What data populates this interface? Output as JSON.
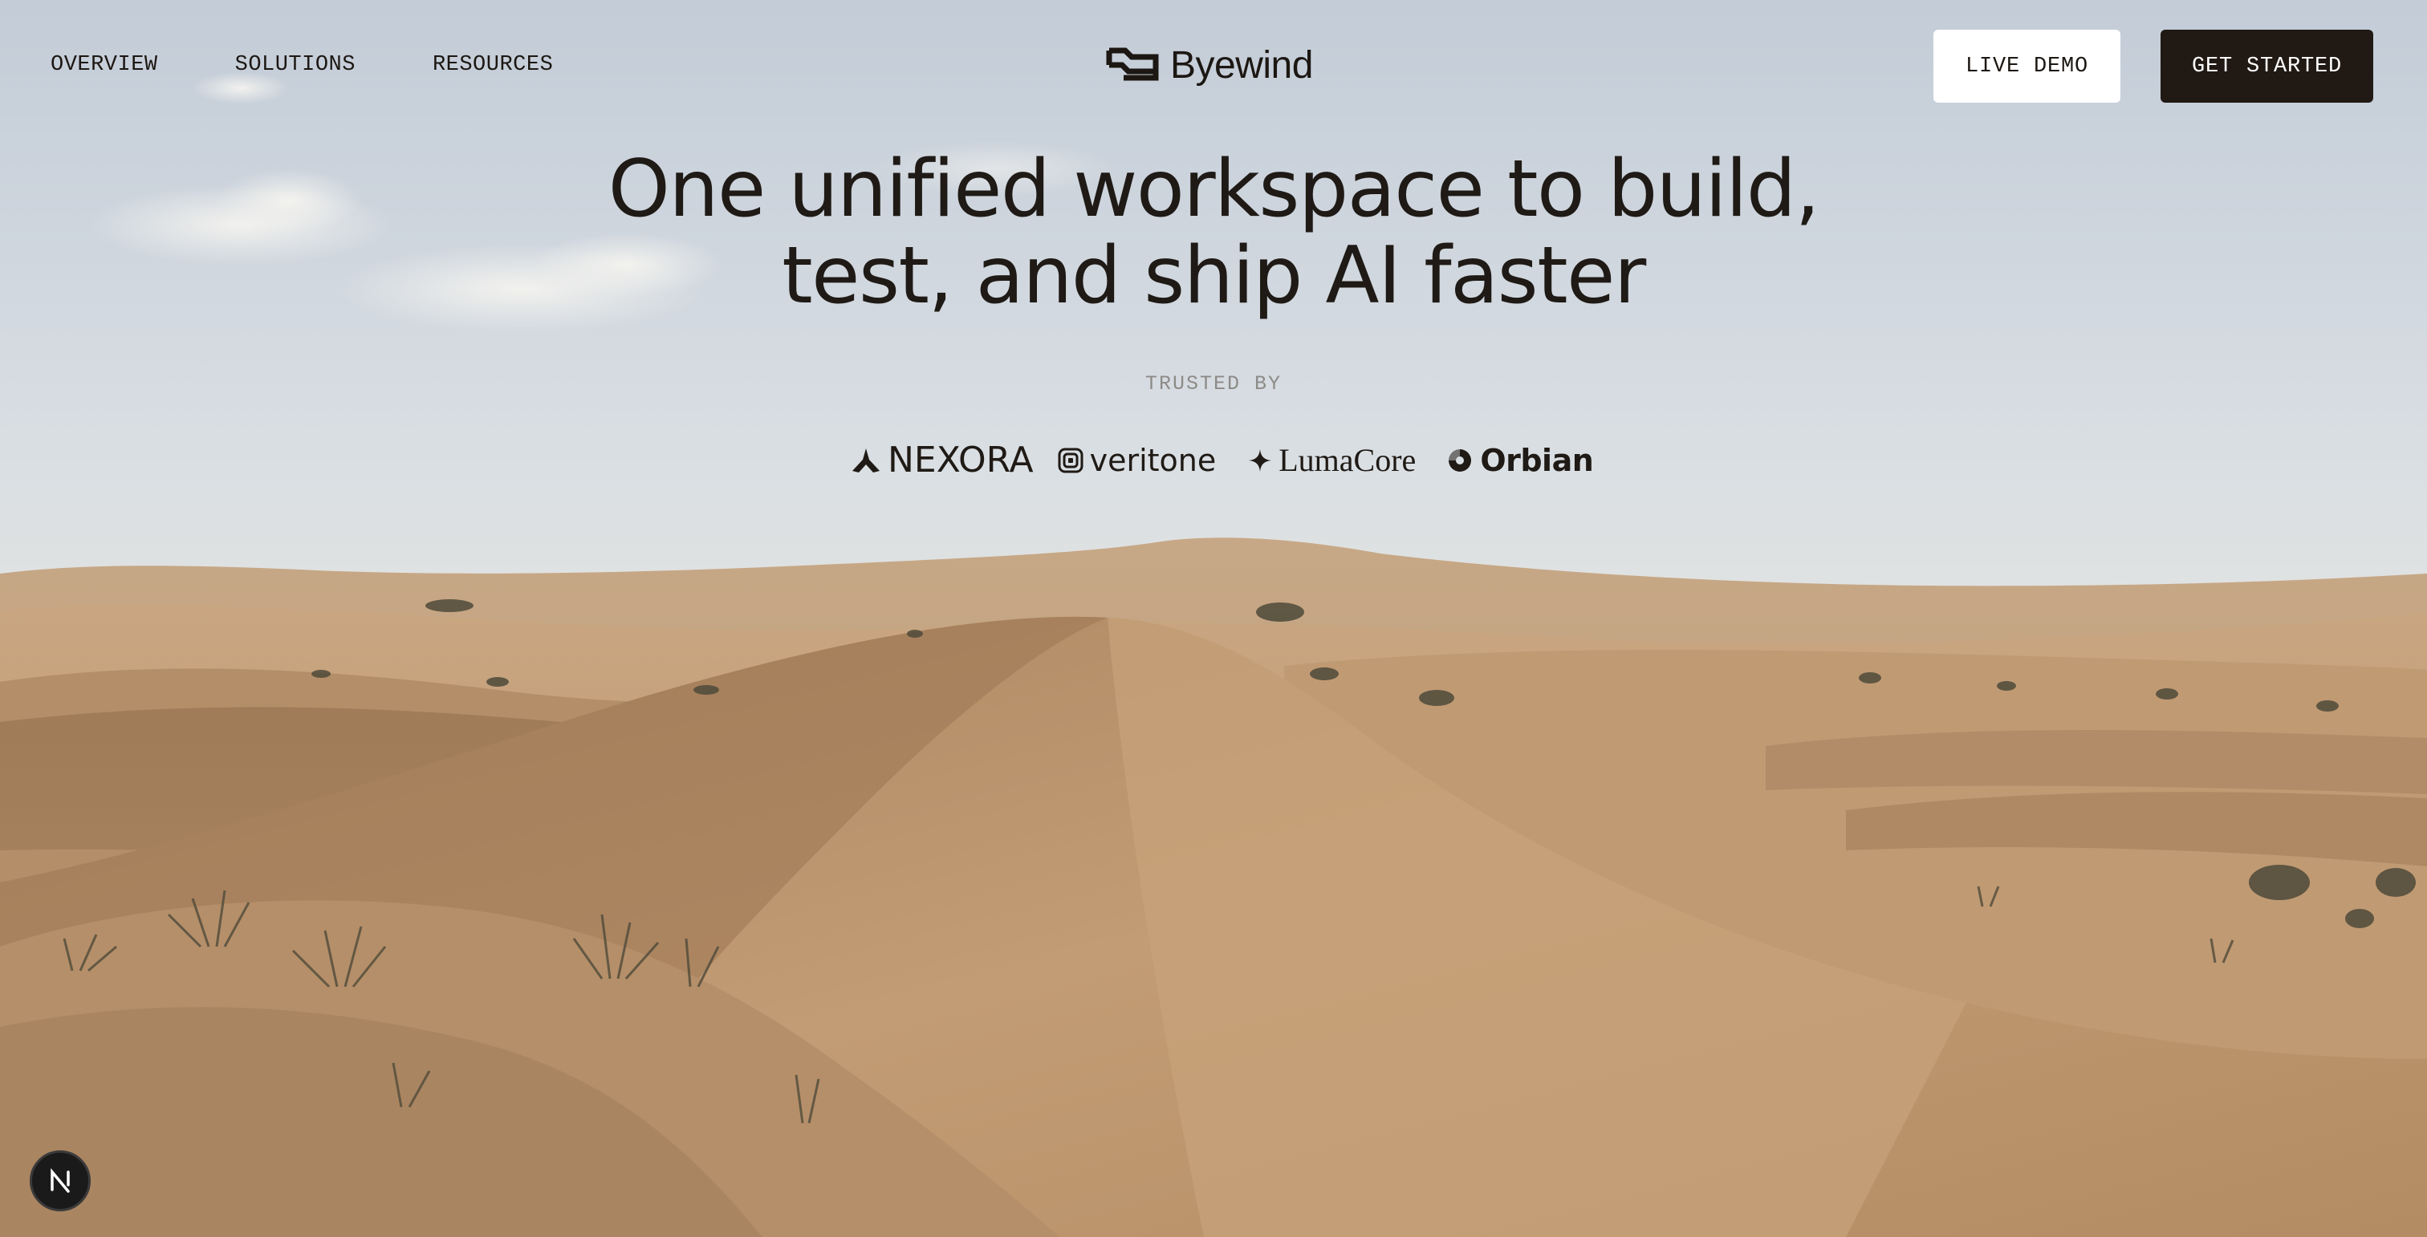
{
  "nav": {
    "links": [
      "OVERVIEW",
      "SOLUTIONS",
      "RESOURCES"
    ],
    "brand": "Byewind",
    "live_demo": "LIVE DEMO",
    "get_started": "GET STARTED"
  },
  "hero": {
    "title_line1": "One unified workspace to build,",
    "title_line2": "test, and ship AI faster",
    "trusted_label": "TRUSTED BY",
    "logos": [
      "NEXORA",
      "veritone",
      "LumaCore",
      "Orbian"
    ]
  },
  "badge": {
    "letter": "N"
  },
  "colors": {
    "ink": "#1c1712",
    "button_dark": "#211914",
    "button_light": "#ffffff",
    "sand": "#c49f78"
  }
}
